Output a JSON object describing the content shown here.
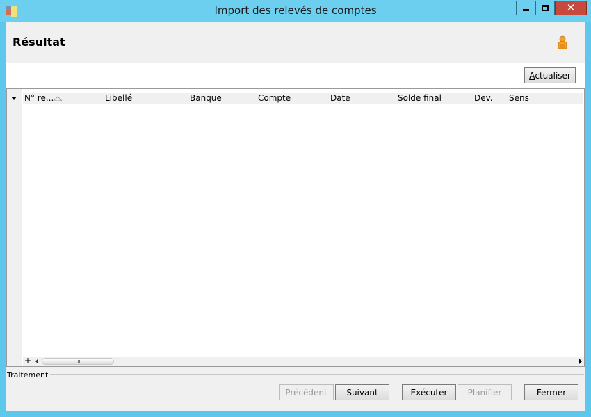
{
  "window": {
    "title": "Import des relevés de comptes",
    "accent_color": "#6ccff0",
    "close_color": "#c7483d"
  },
  "header": {
    "title": "Résultat",
    "icon": "user-icon"
  },
  "toolbar": {
    "refresh_first": "A",
    "refresh_rest": "ctualiser"
  },
  "grid": {
    "columns": [
      "N° re...",
      "Libellé",
      "Banque",
      "Compte",
      "Date",
      "Solde final",
      "Dev.",
      "Sens"
    ],
    "rows": [],
    "add_label": "+"
  },
  "footer": {
    "section_label": "Traitement",
    "buttons": {
      "previous": "Précédent",
      "next": "Suivant",
      "execute": "Exécuter",
      "plan": "Planifier",
      "close": "Fermer"
    }
  }
}
